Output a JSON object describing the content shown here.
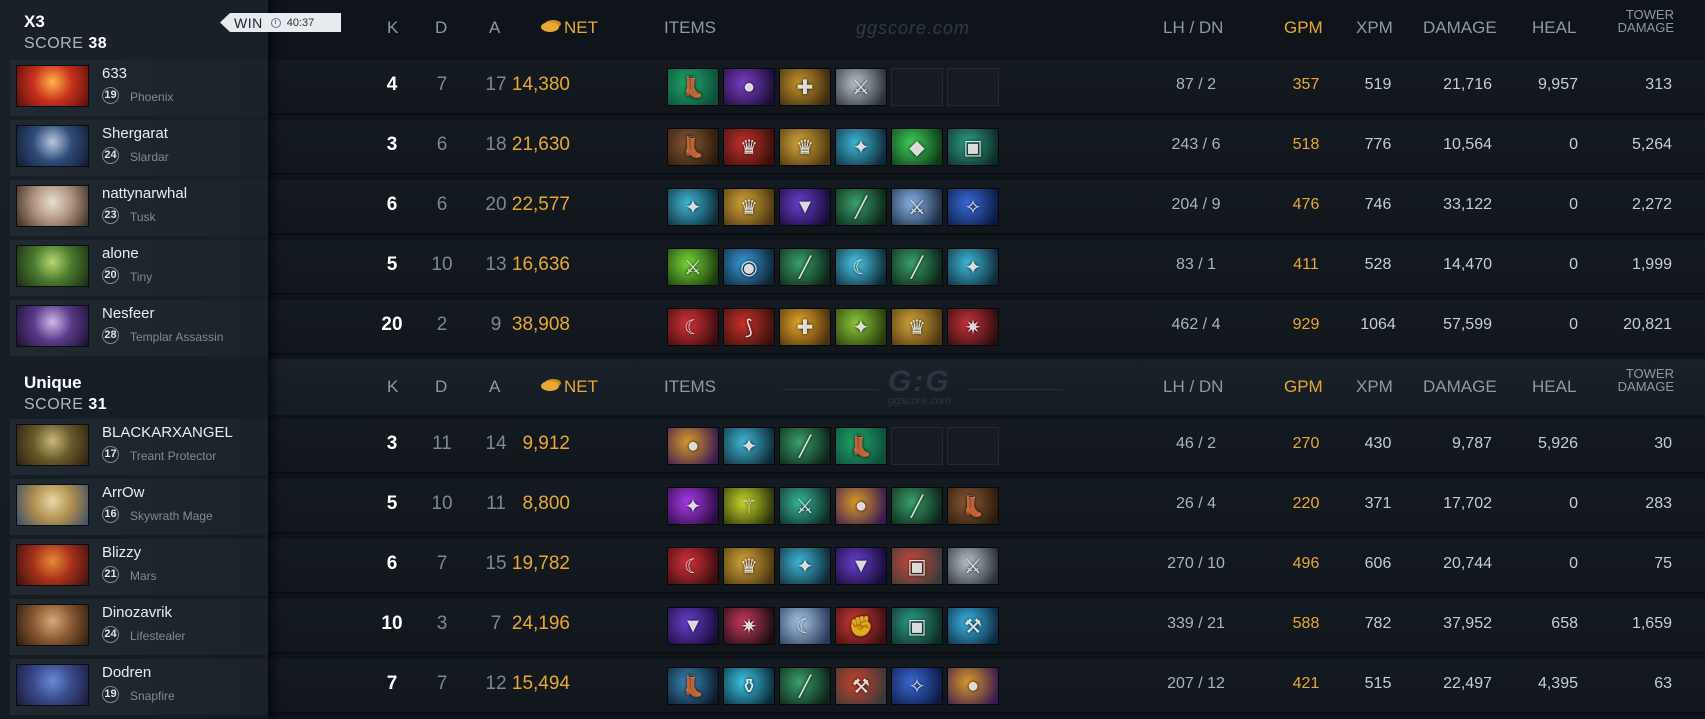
{
  "headers": {
    "k": "K",
    "d": "D",
    "a": "A",
    "net": "NET",
    "items": "ITEMS",
    "lhdn": "LH / DN",
    "gpm": "GPM",
    "xpm": "XPM",
    "damage": "DAMAGE",
    "heal": "HEAL",
    "tower_line1": "TOWER",
    "tower_line2": "DAMAGE"
  },
  "watermark": {
    "site": "ggscore.com",
    "logo": "G:G"
  },
  "teams": [
    {
      "name": "X3",
      "score_label": "SCORE",
      "score": "38",
      "result": "WIN",
      "duration": "40:37",
      "players": [
        {
          "name": "633",
          "level": "19",
          "hero": "Phoenix",
          "k": "4",
          "d": "7",
          "a": "17",
          "net": "14,380",
          "lhdn": "87 / 2",
          "gpm": "357",
          "xpm": "519",
          "damage": "21,716",
          "heal": "9,957",
          "tower": "313",
          "portrait": [
            "#ffb347",
            "#c8321e",
            "#5b0d08"
          ],
          "items": [
            {
              "icon": "boots-icon",
              "c": [
                "#1fa86a",
                "#0d4d3a"
              ],
              "g": "👢"
            },
            {
              "icon": "orb-icon",
              "c": [
                "#7b3fc7",
                "#1b0d35"
              ],
              "g": "●"
            },
            {
              "icon": "cross-icon",
              "c": [
                "#c9952a",
                "#3a2a10"
              ],
              "g": "✚"
            },
            {
              "icon": "blade-icon",
              "c": [
                "#b9c3cc",
                "#2a3036"
              ],
              "g": "⚔"
            },
            {
              "icon": "empty-slot"
            },
            {
              "icon": "empty-slot"
            }
          ]
        },
        {
          "name": "Shergarat",
          "level": "24",
          "hero": "Slardar",
          "k": "3",
          "d": "6",
          "a": "18",
          "net": "21,630",
          "lhdn": "243 / 6",
          "gpm": "518",
          "xpm": "776",
          "damage": "10,564",
          "heal": "0",
          "tower": "5,264",
          "portrait": [
            "#b9c8e0",
            "#2f4c7a",
            "#121b2e"
          ],
          "items": [
            {
              "icon": "boots-icon",
              "c": [
                "#8a5a34",
                "#2a1a0e"
              ],
              "g": "👢"
            },
            {
              "icon": "helm-icon",
              "c": [
                "#c4332b",
                "#3a0e0c"
              ],
              "g": "♛"
            },
            {
              "icon": "gold-helm-icon",
              "c": [
                "#d6a73a",
                "#4a3510"
              ],
              "g": "♛"
            },
            {
              "icon": "axe-icon",
              "c": [
                "#3fb8d8",
                "#0e2a36"
              ],
              "g": "✦"
            },
            {
              "icon": "gem-icon",
              "c": [
                "#3ecf5a",
                "#0e3a18"
              ],
              "g": "◆"
            },
            {
              "icon": "armor-icon",
              "c": [
                "#2ca08a",
                "#0e2a24"
              ],
              "g": "▣"
            }
          ]
        },
        {
          "name": "nattynarwhal",
          "level": "23",
          "hero": "Tusk",
          "k": "6",
          "d": "6",
          "a": "20",
          "net": "22,577",
          "lhdn": "204 / 9",
          "gpm": "476",
          "xpm": "746",
          "damage": "33,122",
          "heal": "0",
          "tower": "2,272",
          "portrait": [
            "#e8e0d0",
            "#b09480",
            "#3a2a20"
          ],
          "items": [
            {
              "icon": "axe-icon",
              "c": [
                "#3fb8d8",
                "#0e2a36"
              ],
              "g": "✦"
            },
            {
              "icon": "gold-helm-icon",
              "c": [
                "#d6a73a",
                "#4a3510"
              ],
              "g": "♛"
            },
            {
              "icon": "cloak-icon",
              "c": [
                "#6a3fd0",
                "#160c35"
              ],
              "g": "▼"
            },
            {
              "icon": "staff-icon",
              "c": [
                "#3aa06a",
                "#0c2418"
              ],
              "g": "╱"
            },
            {
              "icon": "sword-icon",
              "c": [
                "#8ab4e8",
                "#1a2a40"
              ],
              "g": "⚔"
            },
            {
              "icon": "scepter-icon",
              "c": [
                "#3a6ad8",
                "#0c1a40"
              ],
              "g": "✧"
            }
          ]
        },
        {
          "name": "alone",
          "level": "20",
          "hero": "Tiny",
          "k": "5",
          "d": "10",
          "a": "13",
          "net": "16,636",
          "lhdn": "83 / 1",
          "gpm": "411",
          "xpm": "528",
          "damage": "14,470",
          "heal": "0",
          "tower": "1,999",
          "portrait": [
            "#b8d870",
            "#4a7a30",
            "#1a2a12"
          ],
          "items": [
            {
              "icon": "sword-icon",
              "c": [
                "#7ad83a",
                "#1a3a0c"
              ],
              "g": "⚔"
            },
            {
              "icon": "shield-icon",
              "c": [
                "#3a9ad8",
                "#0c2236"
              ],
              "g": "◉"
            },
            {
              "icon": "staff-icon",
              "c": [
                "#3aa06a",
                "#0c2418"
              ],
              "g": "╱"
            },
            {
              "icon": "crescent-icon",
              "c": [
                "#4ac8e8",
                "#0c2a36"
              ],
              "g": "☾"
            },
            {
              "icon": "spear-icon",
              "c": [
                "#3aa06a",
                "#0c2418"
              ],
              "g": "╱"
            },
            {
              "icon": "axe-icon",
              "c": [
                "#3fb8d8",
                "#0e2a36"
              ],
              "g": "✦"
            }
          ]
        },
        {
          "name": "Nesfeer",
          "level": "28",
          "hero": "Templar Assassin",
          "k": "20",
          "d": "2",
          "a": "9",
          "net": "38,908",
          "lhdn": "462 / 4",
          "gpm": "929",
          "xpm": "1064",
          "damage": "57,599",
          "heal": "0",
          "tower": "20,821",
          "portrait": [
            "#d0b8e8",
            "#5a3a8a",
            "#1a1030"
          ],
          "items": [
            {
              "icon": "scythe-icon",
              "c": [
                "#d8323a",
                "#3a0c10"
              ],
              "g": "☾"
            },
            {
              "icon": "bow-icon",
              "c": [
                "#c8322a",
                "#3a100c"
              ],
              "g": "⟆"
            },
            {
              "icon": "mace-icon",
              "c": [
                "#e8a82a",
                "#4a300c"
              ],
              "g": "✚"
            },
            {
              "icon": "dagger-icon",
              "c": [
                "#8ac83a",
                "#2a3a0c"
              ],
              "g": "✦"
            },
            {
              "icon": "gold-helm-icon",
              "c": [
                "#d6a73a",
                "#4a3510"
              ],
              "g": "♛"
            },
            {
              "icon": "claw-icon",
              "c": [
                "#c8323a",
                "#2a0c10"
              ],
              "g": "✷"
            }
          ]
        }
      ]
    },
    {
      "name": "Unique",
      "score_label": "SCORE",
      "score": "31",
      "players": [
        {
          "name": "BLACKARXANGEL",
          "level": "17",
          "hero": "Treant Protector",
          "k": "3",
          "d": "11",
          "a": "14",
          "net": "9,912",
          "lhdn": "46 / 2",
          "gpm": "270",
          "xpm": "430",
          "damage": "9,787",
          "heal": "5,926",
          "tower": "30",
          "portrait": [
            "#c8b878",
            "#6a5a2a",
            "#2a2010"
          ],
          "items": [
            {
              "icon": "pouch-icon",
              "c": [
                "#d89a2a",
                "#3a1a50"
              ],
              "g": "●"
            },
            {
              "icon": "axe-icon",
              "c": [
                "#3fb8d8",
                "#0e2a36"
              ],
              "g": "✦"
            },
            {
              "icon": "staff-icon",
              "c": [
                "#3aa06a",
                "#0c2418"
              ],
              "g": "╱"
            },
            {
              "icon": "boots-icon",
              "c": [
                "#1fa86a",
                "#0d4d3a"
              ],
              "g": "👢"
            },
            {
              "icon": "empty-slot"
            },
            {
              "icon": "empty-slot"
            }
          ]
        },
        {
          "name": "ArrOw",
          "level": "16",
          "hero": "Skywrath Mage",
          "k": "5",
          "d": "10",
          "a": "11",
          "net": "8,800",
          "lhdn": "26 / 4",
          "gpm": "220",
          "xpm": "371",
          "damage": "17,702",
          "heal": "0",
          "tower": "283",
          "portrait": [
            "#e8d8a8",
            "#b09050",
            "#3a4a6a"
          ],
          "items": [
            {
              "icon": "wand-icon",
              "c": [
                "#a83ae8",
                "#2a0c40"
              ],
              "g": "✦"
            },
            {
              "icon": "spear-icon",
              "c": [
                "#c8d82a",
                "#2a300c"
              ],
              "g": "⚚"
            },
            {
              "icon": "glaive-icon",
              "c": [
                "#3ab89a",
                "#0c2a24"
              ],
              "g": "⚔"
            },
            {
              "icon": "pouch-icon",
              "c": [
                "#d89a2a",
                "#3a1a50"
              ],
              "g": "●"
            },
            {
              "icon": "staff-icon",
              "c": [
                "#3aa06a",
                "#0c2418"
              ],
              "g": "╱"
            },
            {
              "icon": "boots-icon",
              "c": [
                "#8a5a34",
                "#2a1a0e"
              ],
              "g": "👢"
            }
          ]
        },
        {
          "name": "Blizzy",
          "level": "21",
          "hero": "Mars",
          "k": "6",
          "d": "7",
          "a": "15",
          "net": "19,782",
          "lhdn": "270 / 10",
          "gpm": "496",
          "xpm": "606",
          "damage": "20,744",
          "heal": "0",
          "tower": "75",
          "portrait": [
            "#e88a3a",
            "#a8321a",
            "#3a100c"
          ],
          "items": [
            {
              "icon": "scythe-icon",
              "c": [
                "#d8323a",
                "#3a0c10"
              ],
              "g": "☾"
            },
            {
              "icon": "gold-helm-icon",
              "c": [
                "#d6a73a",
                "#4a3510"
              ],
              "g": "♛"
            },
            {
              "icon": "axe-icon",
              "c": [
                "#3fb8d8",
                "#0e2a36"
              ],
              "g": "✦"
            },
            {
              "icon": "cloak-icon",
              "c": [
                "#6a3fd0",
                "#160c35"
              ],
              "g": "▼"
            },
            {
              "icon": "armor-icon",
              "c": [
                "#c84a3a",
                "#3a3a3a"
              ],
              "g": "▣"
            },
            {
              "icon": "blade-icon",
              "c": [
                "#b9c3cc",
                "#2a3036"
              ],
              "g": "⚔"
            }
          ]
        },
        {
          "name": "Dinozavrik",
          "level": "24",
          "hero": "Lifestealer",
          "k": "10",
          "d": "3",
          "a": "7",
          "net": "24,196",
          "lhdn": "339 / 21",
          "gpm": "588",
          "xpm": "782",
          "damage": "37,952",
          "heal": "658",
          "tower": "1,659",
          "portrait": [
            "#d8a878",
            "#8a5a34",
            "#2a1a0c"
          ],
          "items": [
            {
              "icon": "cloak-icon",
              "c": [
                "#6a3fd0",
                "#160c35"
              ],
              "g": "▼"
            },
            {
              "icon": "star-icon",
              "c": [
                "#c83a5a",
                "#1a0c14"
              ],
              "g": "✷"
            },
            {
              "icon": "crescent-icon",
              "c": [
                "#a8c8e8",
                "#2a3a5a"
              ],
              "g": "☾"
            },
            {
              "icon": "gauntlet-icon",
              "c": [
                "#d83a3a",
                "#3a1010"
              ],
              "g": "✊"
            },
            {
              "icon": "armor-icon",
              "c": [
                "#2ca08a",
                "#0e2a24"
              ],
              "g": "▣"
            },
            {
              "icon": "hammer-icon",
              "c": [
                "#3ab8e8",
                "#0c2a40"
              ],
              "g": "⚒"
            }
          ]
        },
        {
          "name": "Dodren",
          "level": "19",
          "hero": "Snapfire",
          "k": "7",
          "d": "7",
          "a": "12",
          "net": "15,494",
          "lhdn": "207 / 12",
          "gpm": "421",
          "xpm": "515",
          "damage": "22,497",
          "heal": "4,395",
          "tower": "63",
          "portrait": [
            "#6a8ad8",
            "#3a4a8a",
            "#1a1a3a"
          ],
          "items": [
            {
              "icon": "boots-icon",
              "c": [
                "#3a8ab8",
                "#0c1a2a"
              ],
              "g": "👢"
            },
            {
              "icon": "potion-icon",
              "c": [
                "#3ac8e8",
                "#0c2a3a"
              ],
              "g": "⚱"
            },
            {
              "icon": "staff-icon",
              "c": [
                "#3aa06a",
                "#0c2418"
              ],
              "g": "╱"
            },
            {
              "icon": "axe-icon",
              "c": [
                "#c8422a",
                "#3a3a3a"
              ],
              "g": "⚒"
            },
            {
              "icon": "scepter-icon",
              "c": [
                "#3a6ad8",
                "#0c1a40"
              ],
              "g": "✧"
            },
            {
              "icon": "pouch-icon",
              "c": [
                "#d89a2a",
                "#3a1a50"
              ],
              "g": "●"
            }
          ]
        }
      ]
    }
  ]
}
